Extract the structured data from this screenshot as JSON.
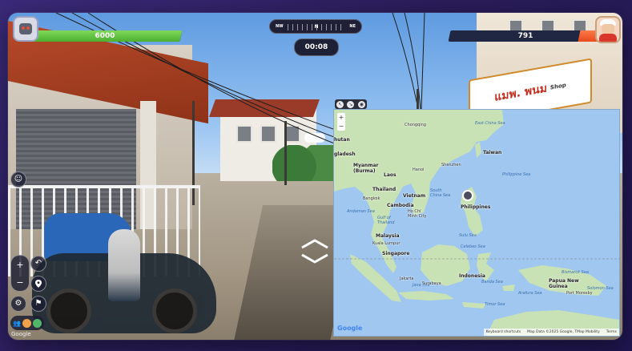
{
  "hud": {
    "player_score": "6000",
    "player_health": 1.0,
    "opponent_score": "791",
    "opponent_health": 0.15,
    "timer": "00:08",
    "compass": {
      "left": "NW",
      "center": "N",
      "right": "NE"
    }
  },
  "street_view": {
    "shop_sign": "แมพ. พนม",
    "shop_sign_sub": "Shop",
    "watermark": "Google"
  },
  "map": {
    "zoom_in": "+",
    "zoom_out": "−",
    "labels": {
      "chongqing": "Chongqing",
      "bhutan": "hutan",
      "bangladesh": "gladesh",
      "myanmar": "Myanmar\n(Burma)",
      "laos": "Laos",
      "thailand": "Thailand",
      "vietnam": "Vietnam",
      "cambodia": "Cambodia",
      "bangkok": "Bangkok",
      "hochiminh": "Ho Chi\nMinh City",
      "hanoi": "Hanoi",
      "shenzhen": "Shenzhen",
      "taiwan": "Taiwan",
      "east_china_sea": "East China Sea",
      "south_china_sea": "South\nChina Sea",
      "philippine_sea": "Philippine Sea",
      "philippines": "Philippines",
      "andaman_sea": "Andaman Sea",
      "gulf_thailand": "Gulf of\nThailand",
      "malaysia": "Malaysia",
      "kuala_lumpur": "Kuala Lumpur",
      "singapore": "Singapore",
      "sulu_sea": "Sulu Sea",
      "celebes_sea": "Celebes Sea",
      "java_sea": "Java Sea",
      "jakarta": "Jakarta",
      "surabaya": "Surabaya",
      "indonesia": "Indonesia",
      "banda_sea": "Banda Sea",
      "timor_sea": "Timor Sea",
      "arafura_sea": "Arafura Sea",
      "papua": "Papua New\nGuinea",
      "bismarck_sea": "Bismarck Sea",
      "solomon_sea": "Solomon Sea",
      "port_moresby": "Port Moresby"
    },
    "google_logo": "Google",
    "footer": {
      "shortcuts": "Keyboard shortcuts",
      "data": "Map Data ©2025 Google, TMap Mobility",
      "terms": "Terms"
    }
  },
  "colors": {
    "player_bar": "#4cae2f",
    "opponent_bar": "#e64a1c",
    "map_water": "#9fc7ef",
    "map_land": "#c9e2b5"
  },
  "icons": {
    "player_avatar": "robot-avatar-icon",
    "opponent_avatar": "old-man-avatar-icon",
    "emoji": "smiley-icon",
    "undo": "undo-icon",
    "pin": "location-pin-icon",
    "flag": "flag-icon",
    "settings": "gear-icon",
    "people": "people-icon"
  }
}
